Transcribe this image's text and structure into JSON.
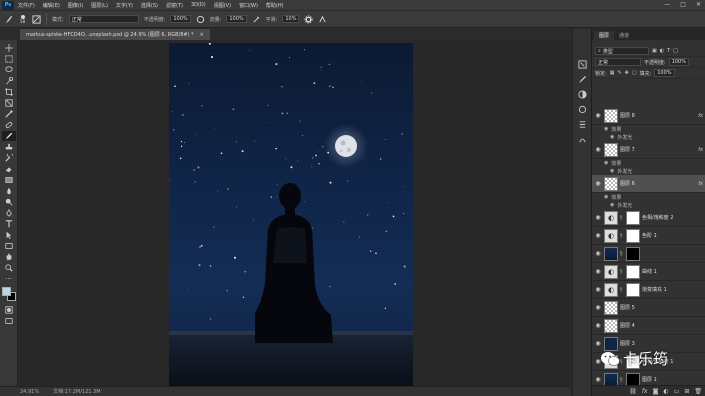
{
  "app": {
    "logo": "Ps"
  },
  "menu": [
    "文件(F)",
    "编辑(E)",
    "图像(I)",
    "图层(L)",
    "文字(Y)",
    "选择(S)",
    "滤镜(T)",
    "3D(D)",
    "视图(V)",
    "窗口(W)",
    "帮助(H)"
  ],
  "window_controls": {
    "minimize": "—",
    "maximize": "□",
    "close": "✕"
  },
  "options": {
    "brush_size": "58",
    "mode_label": "模式:",
    "mode_value": "正常",
    "opacity_label": "不透明度:",
    "opacity_value": "100%",
    "flow_label": "流量:",
    "flow_value": "100%",
    "smooth_label": "平滑:",
    "smooth_value": "10%"
  },
  "document": {
    "tab_title": "markus-spiske-HFCD4O...unsplash.psd @ 24.9% (图层 6, RGB/8#) *",
    "close": "×"
  },
  "status": {
    "zoom": "24.91%",
    "doc_size": "文档:17.2M/121.3M"
  },
  "panel": {
    "tabs": [
      "图层",
      "通道"
    ],
    "kind_label": "类型",
    "blend_mode": "正常",
    "opacity_label": "不透明度:",
    "opacity_value": "100%",
    "lock_label": "锁定:",
    "fill_label": "填充:",
    "fill_value": "100%"
  },
  "layers": [
    {
      "name": "图层 8",
      "thumb": "trans",
      "fx": "fx",
      "effects": "效果",
      "glow": "外发光"
    },
    {
      "name": "图层 7",
      "thumb": "trans",
      "fx": "fx",
      "effects": "效果",
      "glow": "外发光"
    },
    {
      "name": "图层 6",
      "thumb": "trans",
      "fx": "fx",
      "effects": "效果",
      "glow": "外发光",
      "selected": true
    },
    {
      "name": "色相/饱和度 2",
      "thumb": "adj",
      "mask": "white"
    },
    {
      "name": "色阶 1",
      "thumb": "adj",
      "mask": "white"
    },
    {
      "name": "",
      "thumb": "sky",
      "mask": "black"
    },
    {
      "name": "曲线 1",
      "thumb": "adj",
      "mask": "white"
    },
    {
      "name": "渐变填充 1",
      "thumb": "adj",
      "mask": "white"
    },
    {
      "name": "图层 5",
      "thumb": "trans"
    },
    {
      "name": "图层 4",
      "thumb": "trans"
    },
    {
      "name": "图层 3",
      "thumb": "dark"
    },
    {
      "name": "色相/饱和度 1",
      "thumb": "adj",
      "mask": "white"
    },
    {
      "name": "图层 1",
      "thumb": "sky",
      "mask": "black"
    }
  ],
  "watermark": {
    "text": "卡乐筠"
  },
  "colors": {
    "foreground": "#b9d6e8",
    "background": "#000000",
    "ps_blue": "#4fb3ff",
    "selected_layer": "#505050"
  },
  "icons": [
    "brush-icon",
    "move-icon",
    "marquee-icon",
    "lasso-icon",
    "crop-icon",
    "eyedropper-icon",
    "healing-icon",
    "stamp-icon",
    "eraser-icon",
    "gradient-icon",
    "pen-icon",
    "type-icon",
    "hand-icon",
    "zoom-icon",
    "eye-icon",
    "link-icon",
    "trash-icon",
    "new-layer-icon",
    "folder-icon"
  ]
}
